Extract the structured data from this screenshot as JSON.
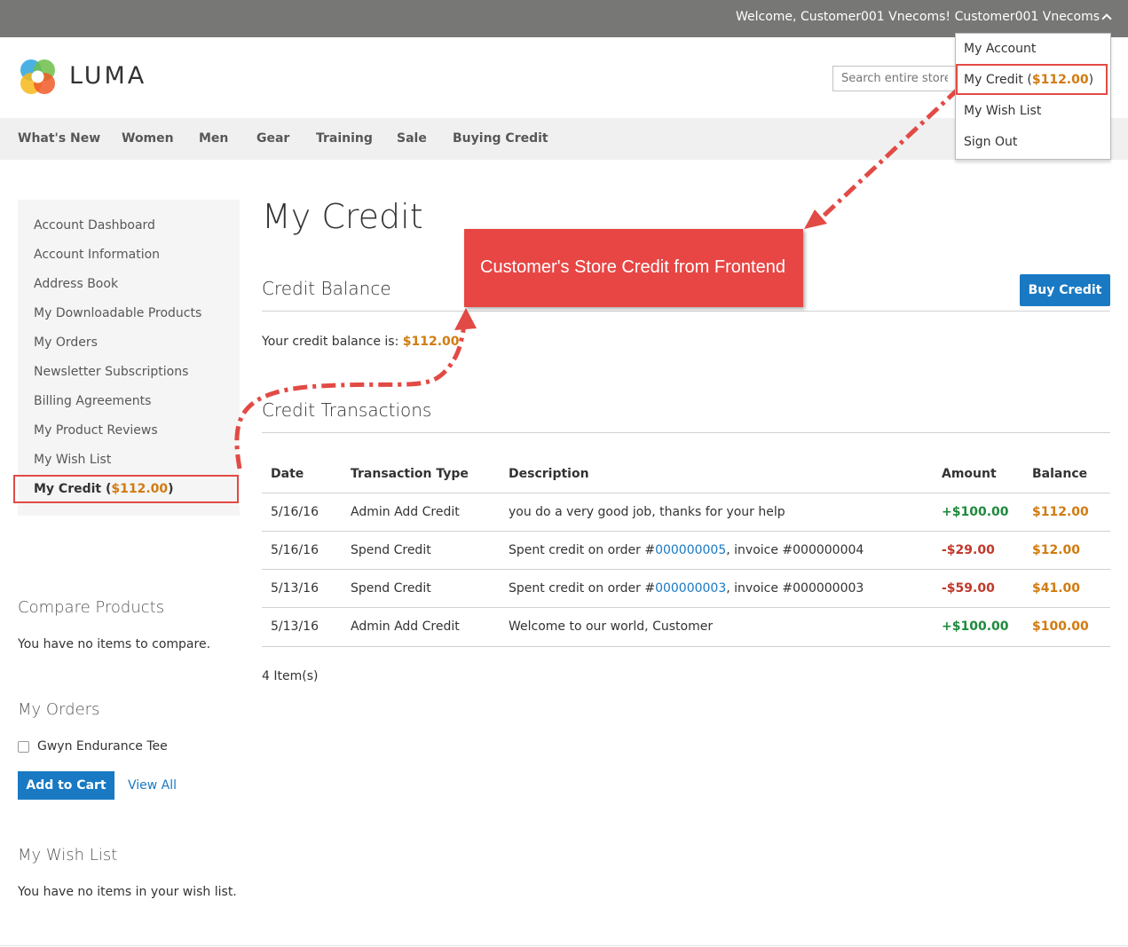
{
  "header": {
    "welcome": "Welcome, Customer001 Vnecoms!",
    "account_name": "Customer001 Vnecoms",
    "logo_text": "LUMA",
    "search_placeholder": "Search entire store here..."
  },
  "dropdown": {
    "my_account": "My Account",
    "my_credit_label": "My Credit (",
    "my_credit_amount": "$112.00",
    "my_credit_close": ")",
    "wish_list": "My Wish List",
    "sign_out": "Sign Out"
  },
  "nav": [
    "What's New",
    "Women",
    "Men",
    "Gear",
    "Training",
    "Sale",
    "Buying Credit"
  ],
  "sidebar": {
    "items": [
      "Account Dashboard",
      "Account Information",
      "Address Book",
      "My Downloadable Products",
      "My Orders",
      "Newsletter Subscriptions",
      "Billing Agreements",
      "My Product Reviews",
      "My Wish List"
    ],
    "active_label": "My Credit (",
    "active_amount": "$112.00",
    "active_close": ")"
  },
  "main": {
    "title": "My Credit",
    "balance_section": "Credit Balance",
    "buy_button": "Buy Credit",
    "balance_label": "Your credit balance is:",
    "balance_amount": "$112.00",
    "transactions_section": "Credit Transactions",
    "item_count": "4 Item(s)"
  },
  "table": {
    "headers": [
      "Date",
      "Transaction Type",
      "Description",
      "Amount",
      "Balance"
    ],
    "rows": [
      {
        "date": "5/16/16",
        "type": "Admin Add Credit",
        "desc_pre": "you do a very good job, thanks for your help",
        "desc_link": "",
        "desc_post": "",
        "amount": "+$100.00",
        "balance": "$112.00"
      },
      {
        "date": "5/16/16",
        "type": "Spend Credit",
        "desc_pre": "Spent credit on order #",
        "desc_link": "000000005",
        "desc_post": ", invoice #000000004",
        "amount": "-$29.00",
        "balance": "$12.00"
      },
      {
        "date": "5/13/16",
        "type": "Spend Credit",
        "desc_pre": "Spent credit on order #",
        "desc_link": "000000003",
        "desc_post": ", invoice #000000003",
        "amount": "-$59.00",
        "balance": "$41.00"
      },
      {
        "date": "5/13/16",
        "type": "Admin Add Credit",
        "desc_pre": "Welcome to our world, Customer",
        "desc_link": "",
        "desc_post": "",
        "amount": "+$100.00",
        "balance": "$100.00"
      }
    ]
  },
  "callout": "Customer's Store Credit from Frontend",
  "blocks": {
    "compare_title": "Compare Products",
    "compare_text": "You have no items to compare.",
    "orders_title": "My Orders",
    "order_item": "Gwyn Endurance Tee",
    "add_to_cart": "Add to Cart",
    "view_all": "View All",
    "wishlist_title": "My Wish List",
    "wishlist_text": "You have no items in your wish list."
  },
  "colors": {
    "topbar": "#777875",
    "accent": "#1979c3",
    "price": "#d17b10",
    "positive": "#1e8a3e",
    "negative": "#c0392b",
    "highlight": "#e24a45"
  }
}
